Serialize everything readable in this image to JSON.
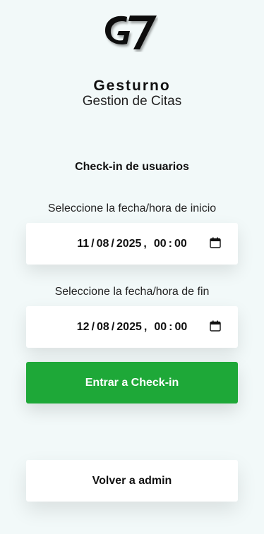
{
  "app": {
    "brand": "Gesturno",
    "subtitle": "Gestion de Citas",
    "logo_text": "G7"
  },
  "checkin": {
    "title": "Check-in de usuarios",
    "start": {
      "label": "Seleccione la fecha/hora de inicio",
      "day": "11",
      "month": "08",
      "year": "2025",
      "hour": "00",
      "minute": "00"
    },
    "end": {
      "label": "Seleccione la fecha/hora de fin",
      "day": "12",
      "month": "08",
      "year": "2025",
      "hour": "00",
      "minute": "00"
    },
    "submit_label": "Entrar a Check-in",
    "back_label": "Volver a admin"
  },
  "colors": {
    "background": "#f2f9f9",
    "primary_button": "#1ea838"
  }
}
